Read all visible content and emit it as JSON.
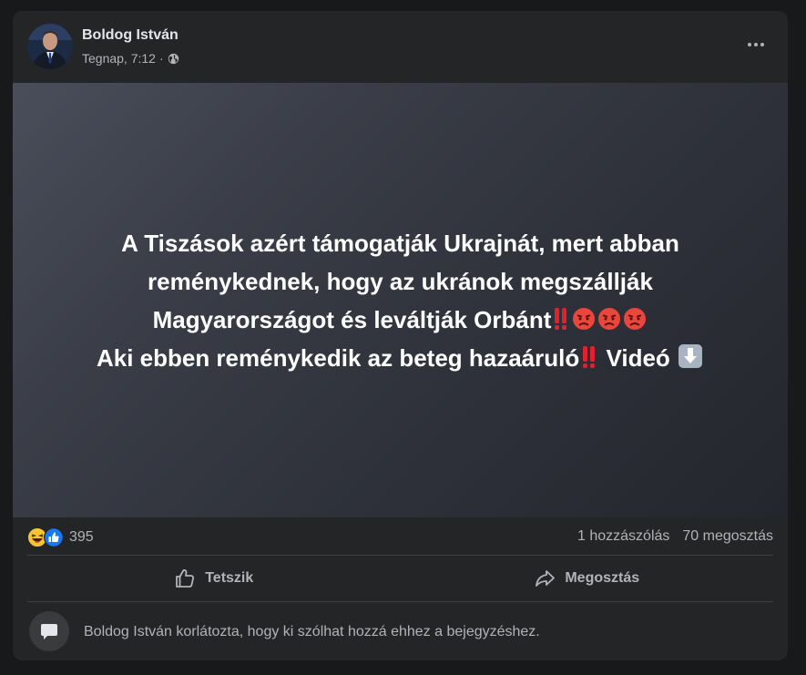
{
  "post": {
    "author": "Boldog István",
    "time": "Tegnap, 7:12",
    "separator": "·",
    "privacy_icon": "globe-icon",
    "more_icon": "more-options-icon",
    "media_lines": [
      "A Tiszások azért támogatják Ukrajnát, mert abban",
      "reménykednek, hogy az ukránok megszállják",
      "Magyarországot és leváltják Orbánt",
      "Aki ebben reménykedik az beteg hazaáruló",
      "Videó"
    ],
    "reaction_icons": [
      "haha-reaction-icon",
      "like-reaction-icon"
    ],
    "reaction_count": "395",
    "comments": "1 hozzászólás",
    "shares": "70 megosztás",
    "actions": {
      "like_label": "Tetszik",
      "share_label": "Megosztás"
    },
    "restricted_text": "Boldog István korlátozta, hogy ki szólhat hozzá ehhez a bejegyzéshez."
  },
  "colors": {
    "card": "#242526",
    "text_primary": "#e4e6eb",
    "text_secondary": "#b0b3b8",
    "like_blue": "#1877f2"
  }
}
